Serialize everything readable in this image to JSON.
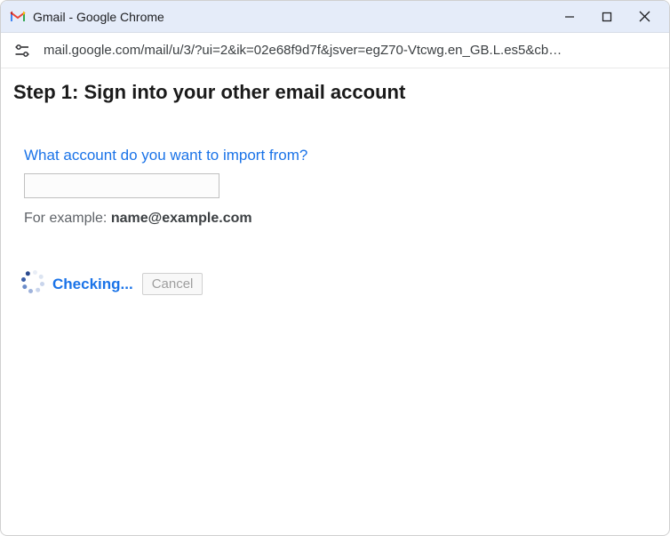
{
  "window": {
    "title": "Gmail - Google Chrome"
  },
  "addressbar": {
    "url": "mail.google.com/mail/u/3/?ui=2&ik=02e68f9d7f&jsver=egZ70-Vtcwg.en_GB.L.es5&cb…"
  },
  "page": {
    "heading": "Step 1: Sign into your other email account",
    "prompt": "What account do you want to import from?",
    "input_value": "",
    "example_prefix": "For example: ",
    "example_email": "name@example.com",
    "status": "Checking...",
    "cancel": "Cancel"
  }
}
